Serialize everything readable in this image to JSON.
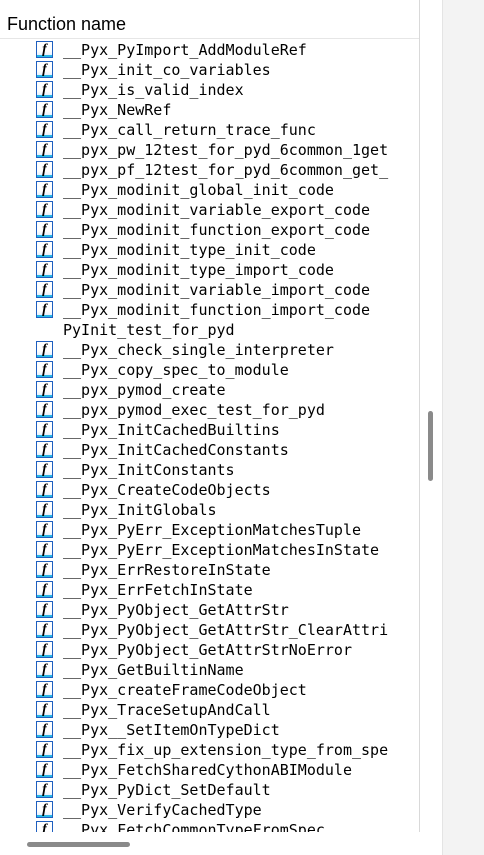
{
  "header": {
    "title": "Function name"
  },
  "functions": [
    {
      "name": "__Pyx_PyImport_AddModuleRef",
      "icon": true
    },
    {
      "name": "__Pyx_init_co_variables",
      "icon": true
    },
    {
      "name": "__Pyx_is_valid_index",
      "icon": true
    },
    {
      "name": "__Pyx_NewRef",
      "icon": true
    },
    {
      "name": "__Pyx_call_return_trace_func",
      "icon": true
    },
    {
      "name": "__pyx_pw_12test_for_pyd_6common_1get",
      "icon": true
    },
    {
      "name": "__pyx_pf_12test_for_pyd_6common_get_",
      "icon": true
    },
    {
      "name": "__Pyx_modinit_global_init_code",
      "icon": true
    },
    {
      "name": "__Pyx_modinit_variable_export_code",
      "icon": true
    },
    {
      "name": "__Pyx_modinit_function_export_code",
      "icon": true
    },
    {
      "name": "__Pyx_modinit_type_init_code",
      "icon": true
    },
    {
      "name": "__Pyx_modinit_type_import_code",
      "icon": true
    },
    {
      "name": "__Pyx_modinit_variable_import_code",
      "icon": true
    },
    {
      "name": "__Pyx_modinit_function_import_code",
      "icon": true
    },
    {
      "name": "PyInit_test_for_pyd",
      "icon": false
    },
    {
      "name": "__Pyx_check_single_interpreter",
      "icon": true
    },
    {
      "name": "__Pyx_copy_spec_to_module",
      "icon": true
    },
    {
      "name": "__pyx_pymod_create",
      "icon": true
    },
    {
      "name": "__pyx_pymod_exec_test_for_pyd",
      "icon": true
    },
    {
      "name": "__Pyx_InitCachedBuiltins",
      "icon": true
    },
    {
      "name": "__Pyx_InitCachedConstants",
      "icon": true
    },
    {
      "name": "__Pyx_InitConstants",
      "icon": true
    },
    {
      "name": "__Pyx_CreateCodeObjects",
      "icon": true
    },
    {
      "name": "__Pyx_InitGlobals",
      "icon": true
    },
    {
      "name": "__Pyx_PyErr_ExceptionMatchesTuple",
      "icon": true
    },
    {
      "name": "__Pyx_PyErr_ExceptionMatchesInState",
      "icon": true
    },
    {
      "name": "__Pyx_ErrRestoreInState",
      "icon": true
    },
    {
      "name": "__Pyx_ErrFetchInState",
      "icon": true
    },
    {
      "name": "__Pyx_PyObject_GetAttrStr",
      "icon": true
    },
    {
      "name": "__Pyx_PyObject_GetAttrStr_ClearAttri",
      "icon": true
    },
    {
      "name": "__Pyx_PyObject_GetAttrStrNoError",
      "icon": true
    },
    {
      "name": "__Pyx_GetBuiltinName",
      "icon": true
    },
    {
      "name": "__Pyx_createFrameCodeObject",
      "icon": true
    },
    {
      "name": "__Pyx_TraceSetupAndCall",
      "icon": true
    },
    {
      "name": "__Pyx__SetItemOnTypeDict",
      "icon": true
    },
    {
      "name": "__Pyx_fix_up_extension_type_from_spe",
      "icon": true
    },
    {
      "name": "__Pyx_FetchSharedCythonABIModule",
      "icon": true
    },
    {
      "name": "__Pyx_PyDict_SetDefault",
      "icon": true
    },
    {
      "name": "__Pyx_VerifyCachedType",
      "icon": true
    },
    {
      "name": "__Pyx_FetchCommonTypeFromSpec",
      "icon": true
    }
  ],
  "icons": {
    "function": "function-icon",
    "glyph": "f"
  },
  "colors": {
    "icon_border": "#1f5fbf",
    "icon_accent": "#28b8e8"
  }
}
